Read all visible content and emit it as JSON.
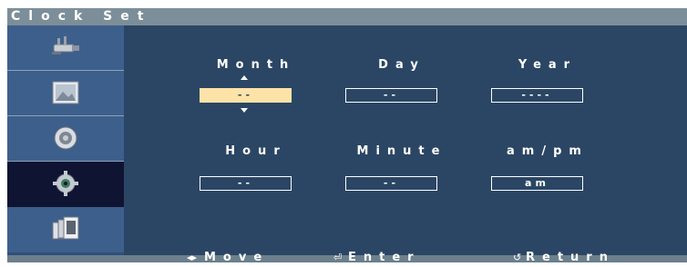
{
  "window": {
    "title": "Clock Set"
  },
  "sidebar": {
    "items": [
      {
        "icon": "input-connector-icon",
        "active": false
      },
      {
        "icon": "picture-icon",
        "active": false
      },
      {
        "icon": "speaker-icon",
        "active": false
      },
      {
        "icon": "gear-icon",
        "active": true
      },
      {
        "icon": "multi-window-icon",
        "active": false
      }
    ]
  },
  "clock": {
    "month": {
      "label": "Month",
      "value": "--",
      "focused": true
    },
    "day": {
      "label": "Day",
      "value": "--"
    },
    "year": {
      "label": "Year",
      "value": "----"
    },
    "hour": {
      "label": "Hour",
      "value": "--"
    },
    "minute": {
      "label": "Minute",
      "value": "--"
    },
    "ampm": {
      "label": "am/pm",
      "value": "am"
    }
  },
  "footer": {
    "move": "Move",
    "enter": "Enter",
    "return": "Return"
  },
  "colors": {
    "panel": "#2b4664",
    "sidebar": "#3d5f8b",
    "active": "#0f1432",
    "focus": "#fde3a7"
  }
}
